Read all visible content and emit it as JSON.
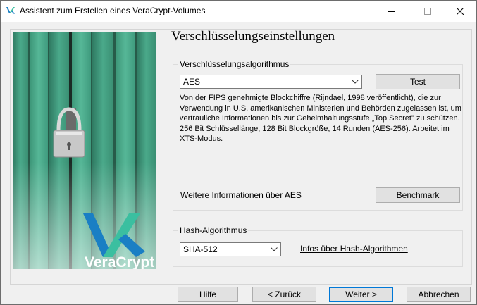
{
  "window": {
    "title": "Assistent zum Erstellen eines VeraCrypt-Volumes"
  },
  "side_image": {
    "logo_text": "VeraCrypt"
  },
  "page": {
    "title": "Verschlüsselungseinstellungen"
  },
  "encryption": {
    "group_label": "Verschlüsselungsalgorithmus",
    "selected_algorithm": "AES",
    "test_button": "Test",
    "description": "Von der FIPS genehmigte Blockchiffre (Rijndael, 1998 veröffentlicht), die zur Verwendung in U.S. amerikanischen Ministerien und Behörden zugelassen ist, um vertrauliche Informationen bis zur Geheimhaltungsstufe „Top Secret\" zu schützen. 256 Bit Schlüssellänge, 128 Bit Blockgröße, 14 Runden (AES-256). Arbeitet im XTS-Modus.",
    "more_info_link": "Weitere Informationen über AES",
    "benchmark_button": "Benchmark"
  },
  "hash": {
    "group_label": "Hash-Algorithmus",
    "selected_algorithm": "SHA-512",
    "info_link": "Infos über Hash-Algorithmen"
  },
  "footer": {
    "help_button": "Hilfe",
    "back_button": "< Zurück",
    "next_button": "Weiter >",
    "cancel_button": "Abbrechen"
  },
  "colors": {
    "accent": "#0078d7",
    "wood_green": "#3f9b7e",
    "logo_blue": "#1a7fc4",
    "logo_teal": "#3bbfa0"
  }
}
